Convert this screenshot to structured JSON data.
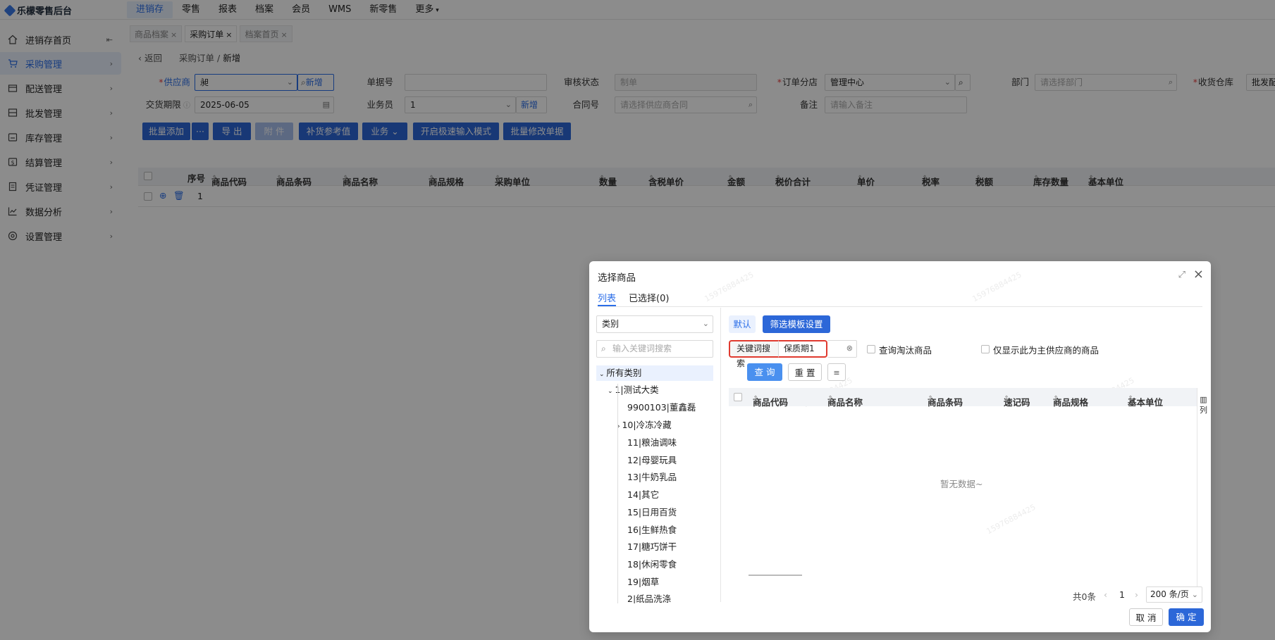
{
  "app": {
    "title": "乐檬零售后台"
  },
  "topnav": [
    "进销存",
    "零售",
    "报表",
    "档案",
    "会员",
    "WMS",
    "新零售",
    "更多"
  ],
  "sidebar": {
    "items": [
      {
        "label": "进销存首页"
      },
      {
        "label": "采购管理"
      },
      {
        "label": "配送管理"
      },
      {
        "label": "批发管理"
      },
      {
        "label": "库存管理"
      },
      {
        "label": "结算管理"
      },
      {
        "label": "凭证管理"
      },
      {
        "label": "数据分析"
      },
      {
        "label": "设置管理"
      }
    ]
  },
  "tabs": [
    "商品档案",
    "采购订单",
    "档案首页"
  ],
  "breadcrumb": {
    "back": "返回",
    "parent": "采购订单",
    "sep": "/",
    "current": "新增"
  },
  "form": {
    "supplier_label": "供应商",
    "supplier_value": "昶",
    "supplier_add": "新增",
    "bill_no_label": "单据号",
    "bill_no_value": "",
    "audit_label": "审核状态",
    "audit_value": "制单",
    "branch_label": "订单分店",
    "branch_value": "管理中心",
    "dept_label": "部门",
    "dept_placeholder": "请选择部门",
    "warehouse_label": "收货仓库",
    "warehouse_value": "批发配",
    "date_label": "交货期限",
    "date_value": "2025-06-05",
    "clerk_label": "业务员",
    "clerk_value": "1",
    "clerk_add": "新增",
    "contract_label": "合同号",
    "contract_placeholder": "请选择供应商合同",
    "remark_label": "备注",
    "remark_placeholder": "请输入备注"
  },
  "toolbar": {
    "batch_add": "批量添加",
    "more": "···",
    "export": "导 出",
    "attach": "附 件",
    "replenish": "补货参考值",
    "business": "业务",
    "fast_mode": "开启极速输入模式",
    "batch_edit": "批量修改单据"
  },
  "grid": {
    "columns": [
      "序号",
      "商品代码",
      "商品条码",
      "商品名称",
      "商品规格",
      "采购单位",
      "数量",
      "含税单价",
      "金额",
      "税价合计",
      "单价",
      "税率",
      "税额",
      "库存数量",
      "基本单位"
    ],
    "rows": [
      {
        "index": "1"
      }
    ]
  },
  "modal": {
    "title": "选择商品",
    "tabs": [
      "列表",
      "已选择(0)"
    ],
    "category_select": "类别",
    "tree_search_placeholder": "输入关键词搜索",
    "tree": [
      "所有类别",
      "1|测试大类",
      "9900103|董鑫磊",
      "10|冷冻冷藏",
      "11|粮油调味",
      "12|母婴玩具",
      "13|牛奶乳品",
      "14|其它",
      "15|日用百货",
      "16|生鲜热食",
      "17|糖巧饼干",
      "18|休闲零食",
      "19|烟草",
      "2|纸品洗涤"
    ],
    "filter_default": "默认",
    "filter_template": "筛选模板设置",
    "keyword_label": "关键词搜索",
    "keyword_value": "保质期1",
    "chk_eliminated": "查询淘汰商品",
    "chk_main_supplier": "仅显示此为主供应商的商品",
    "query": "查 询",
    "reset": "重 置",
    "columns": [
      "商品代码",
      "商品名称",
      "商品条码",
      "速记码",
      "商品规格",
      "基本单位"
    ],
    "col_setting": "列",
    "empty": "暂无数据~",
    "total": "共0条",
    "page": "1",
    "page_size": "200 条/页",
    "cancel": "取 消",
    "ok": "确 定"
  },
  "colors": {
    "primary": "#2c67d8",
    "highlight": "#e03a2f"
  }
}
